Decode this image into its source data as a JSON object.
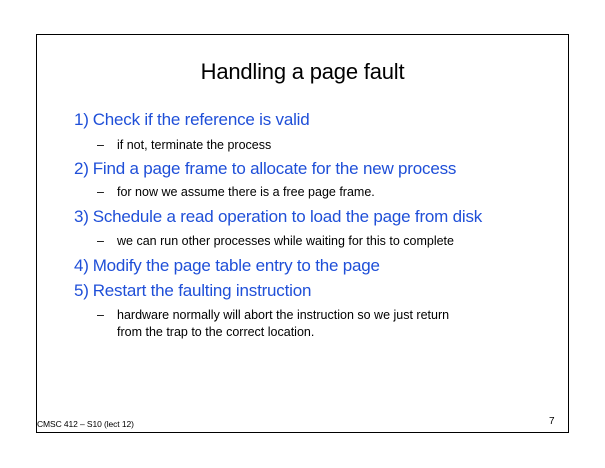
{
  "slide": {
    "title": "Handling a page fault",
    "accent_color": "#1f4fd8",
    "items": [
      {
        "number": "1)",
        "text": "Check if the reference is valid",
        "sub": "if not, terminate the process"
      },
      {
        "number": "2)",
        "text": "Find a page frame to allocate for the new process",
        "sub": "for now we assume there is a free page frame."
      },
      {
        "number": "3)",
        "text": "Schedule a read operation to load the page from disk",
        "sub": "we can run other processes while waiting for this to complete"
      },
      {
        "number": "4)",
        "text": "Modify the page table entry to the page"
      },
      {
        "number": "5)",
        "text": "Restart the faulting instruction",
        "sub": "hardware normally will abort the instruction so we just return",
        "sub_continuation": "from the trap to the correct location."
      }
    ],
    "dash": "–",
    "footer": "CMSC 412 – S10 (lect 12)",
    "page_number": "7"
  }
}
